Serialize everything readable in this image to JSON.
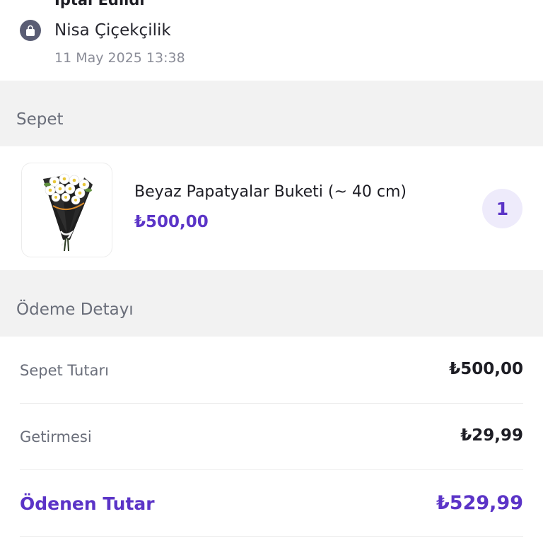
{
  "order": {
    "status": "İptal Edildi",
    "store_name": "Nisa Çiçekçilik",
    "date": "11 May 2025 13:38",
    "store_icon": "shopping-bag-icon"
  },
  "basket": {
    "title": "Sepet",
    "items": [
      {
        "name": "Beyaz Papatyalar Buketi (~ 40 cm)",
        "price": "₺500,00",
        "quantity": "1",
        "image": "white-daisy-bouquet"
      }
    ]
  },
  "payment": {
    "title": "Ödeme Detayı",
    "rows": [
      {
        "label": "Sepet Tutarı",
        "value": "₺500,00"
      },
      {
        "label": "Getirmesi",
        "value": "₺29,99"
      }
    ],
    "total": {
      "label": "Ödenen Tutar",
      "value": "₺529,99"
    }
  },
  "colors": {
    "accent": "#5b34c7",
    "section_bg": "#f2f2f2",
    "muted_text": "#6a6e7a",
    "badge_bg": "#eeebfb"
  }
}
